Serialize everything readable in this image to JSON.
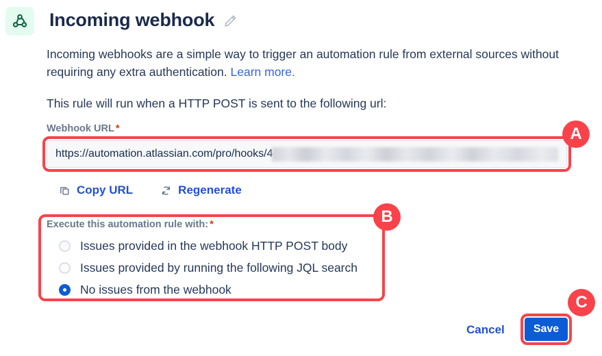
{
  "header": {
    "icon": "webhook-icon",
    "title": "Incoming webhook",
    "edit_icon": "pencil-edit-icon"
  },
  "description": {
    "intro_before_link": "Incoming webhooks are a simple way to trigger an automation rule from external sources without requiring any extra authentication. ",
    "link_label": "Learn more.",
    "rule_line": "This rule will run when a HTTP POST is sent to the following url:"
  },
  "url_field": {
    "label": "Webhook URL",
    "required_mark": "*",
    "value": "https://automation.atlassian.com/pro/hooks/4",
    "redacted": true
  },
  "actions": {
    "copy_label": "Copy URL",
    "copy_icon": "copy-icon",
    "regenerate_label": "Regenerate",
    "regenerate_icon": "refresh-icon"
  },
  "radio_group": {
    "label": "Execute this automation rule with:",
    "required_mark": "*",
    "options": [
      {
        "label": "Issues provided in the webhook HTTP POST body",
        "selected": false
      },
      {
        "label": "Issues provided by running the following JQL search",
        "selected": false
      },
      {
        "label": "No issues from the webhook",
        "selected": true
      }
    ]
  },
  "footer": {
    "cancel_label": "Cancel",
    "save_label": "Save"
  },
  "annotations": {
    "a": "A",
    "b": "B",
    "c": "C"
  },
  "colors": {
    "accent_blue": "#0B5CD5",
    "link_blue": "#3366DD",
    "annotation_red": "#F8434A",
    "required_red": "#DE350B",
    "icon_green": "#0B6340",
    "icon_bg_green": "#E3FCEF",
    "label_gray": "#6B778C",
    "text_navy": "#253858"
  }
}
